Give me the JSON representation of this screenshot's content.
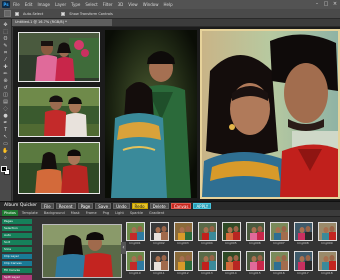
{
  "menu": {
    "logo": "Ps",
    "items": [
      "File",
      "Edit",
      "Image",
      "Layer",
      "Type",
      "Select",
      "Filter",
      "3D",
      "View",
      "Window",
      "Help"
    ],
    "window_controls": [
      "–",
      "□",
      "×"
    ]
  },
  "options": {
    "auto_select": "Auto-Select",
    "transform": "Show Transform Controls"
  },
  "document": {
    "tab": "Untitled-1 @ 16.7% (RGB/8) *"
  },
  "tools": {
    "icons": [
      "move-icon",
      "marquee-icon",
      "lasso-icon",
      "quick-select-icon",
      "crop-icon",
      "eyedropper-icon",
      "healing-icon",
      "brush-icon",
      "stamp-icon",
      "history-brush-icon",
      "eraser-icon",
      "gradient-icon",
      "blur-icon",
      "dodge-icon",
      "pen-icon",
      "type-icon",
      "path-select-icon",
      "shape-icon",
      "hand-icon",
      "zoom-icon"
    ],
    "glyphs": [
      "✥",
      "⬚",
      "ʘ",
      "✎",
      "⌗",
      "⁄",
      "✚",
      "✏",
      "⊕",
      "↺",
      "◫",
      "▤",
      "◌",
      "●",
      "✒",
      "T",
      "↖",
      "▭",
      "✋",
      "⌕"
    ]
  },
  "panel": {
    "title": "Album Quicker",
    "header_buttons": [
      "File",
      "Recent",
      "Page",
      "Save",
      "Undo",
      "Redo",
      "Delete",
      "Canvas",
      "APPLY"
    ],
    "tabs": [
      "Photos",
      "Template",
      "Background",
      "Mask",
      "Frame",
      "Png",
      "Light",
      "Sparkle",
      "Gradient"
    ],
    "active_tab_index": 0,
    "sidebar": [
      "Pages",
      "Selection",
      "Auto",
      "Sort",
      "Slice",
      "Clip Layer",
      "Clip Canvas",
      "Fill Canvas",
      "Split Layer",
      "Fit Canvas",
      "Auto Save"
    ],
    "thumb_labels_row1": [
      "Img001",
      "Img002",
      "Img003",
      "Img004",
      "Img005",
      "Img006",
      "Img007",
      "Img008",
      "Img009"
    ],
    "thumb_labels_row2": [
      "Img010",
      "Img011",
      "Img012",
      "Img013",
      "Img014",
      "Img015",
      "Img016",
      "Img017",
      "Img018"
    ],
    "nav_left": "‹",
    "nav_right": "›"
  },
  "colors": {
    "frame_gold": "#e6d29a",
    "apply": "#2aa1b8",
    "active_tab": "#1f7a30"
  }
}
